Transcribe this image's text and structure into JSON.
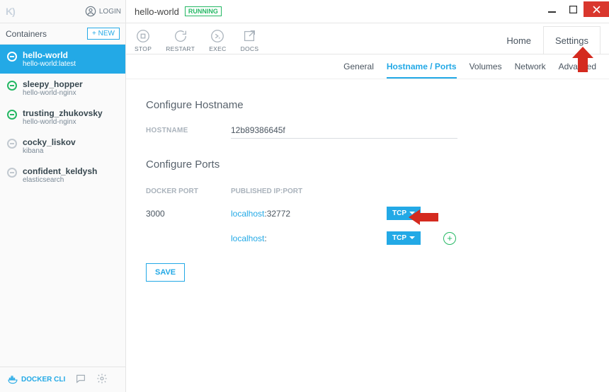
{
  "window": {
    "title": "hello-world",
    "status_badge": "RUNNING"
  },
  "sidebar": {
    "login_label": "LOGIN",
    "header": "Containers",
    "new_btn": "+  NEW",
    "items": [
      {
        "name": "hello-world",
        "sub": "hello-world:latest",
        "status": "running",
        "active": true
      },
      {
        "name": "sleepy_hopper",
        "sub": "hello-world-nginx",
        "status": "running",
        "active": false
      },
      {
        "name": "trusting_zhukovsky",
        "sub": "hello-world-nginx",
        "status": "running",
        "active": false
      },
      {
        "name": "cocky_liskov",
        "sub": "kibana",
        "status": "stopped",
        "active": false
      },
      {
        "name": "confident_keldysh",
        "sub": "elasticsearch",
        "status": "stopped",
        "active": false
      }
    ],
    "footer": {
      "cli": "DOCKER CLI"
    }
  },
  "toolbar": {
    "items": [
      {
        "id": "stop",
        "label": "STOP"
      },
      {
        "id": "restart",
        "label": "RESTART"
      },
      {
        "id": "exec",
        "label": "EXEC"
      },
      {
        "id": "docs",
        "label": "DOCS"
      }
    ]
  },
  "main_tabs": {
    "home": "Home",
    "settings": "Settings"
  },
  "sub_tabs": [
    {
      "id": "general",
      "label": "General",
      "active": false
    },
    {
      "id": "hostname",
      "label": "Hostname / Ports",
      "active": true
    },
    {
      "id": "volumes",
      "label": "Volumes",
      "active": false
    },
    {
      "id": "network",
      "label": "Network",
      "active": false
    },
    {
      "id": "advanced",
      "label": "Advanced",
      "active": false
    }
  ],
  "hostname_section": {
    "title": "Configure Hostname",
    "label": "HOSTNAME",
    "value": "12b89386645f"
  },
  "ports_section": {
    "title": "Configure Ports",
    "cols": {
      "docker": "DOCKER PORT",
      "published": "PUBLISHED IP:PORT"
    },
    "rows": [
      {
        "docker_port": "3000",
        "host": "localhost",
        "port": ":32772",
        "proto": "TCP"
      },
      {
        "docker_port": "",
        "host": "localhost",
        "port": ":",
        "proto": "TCP"
      }
    ],
    "save": "SAVE"
  }
}
